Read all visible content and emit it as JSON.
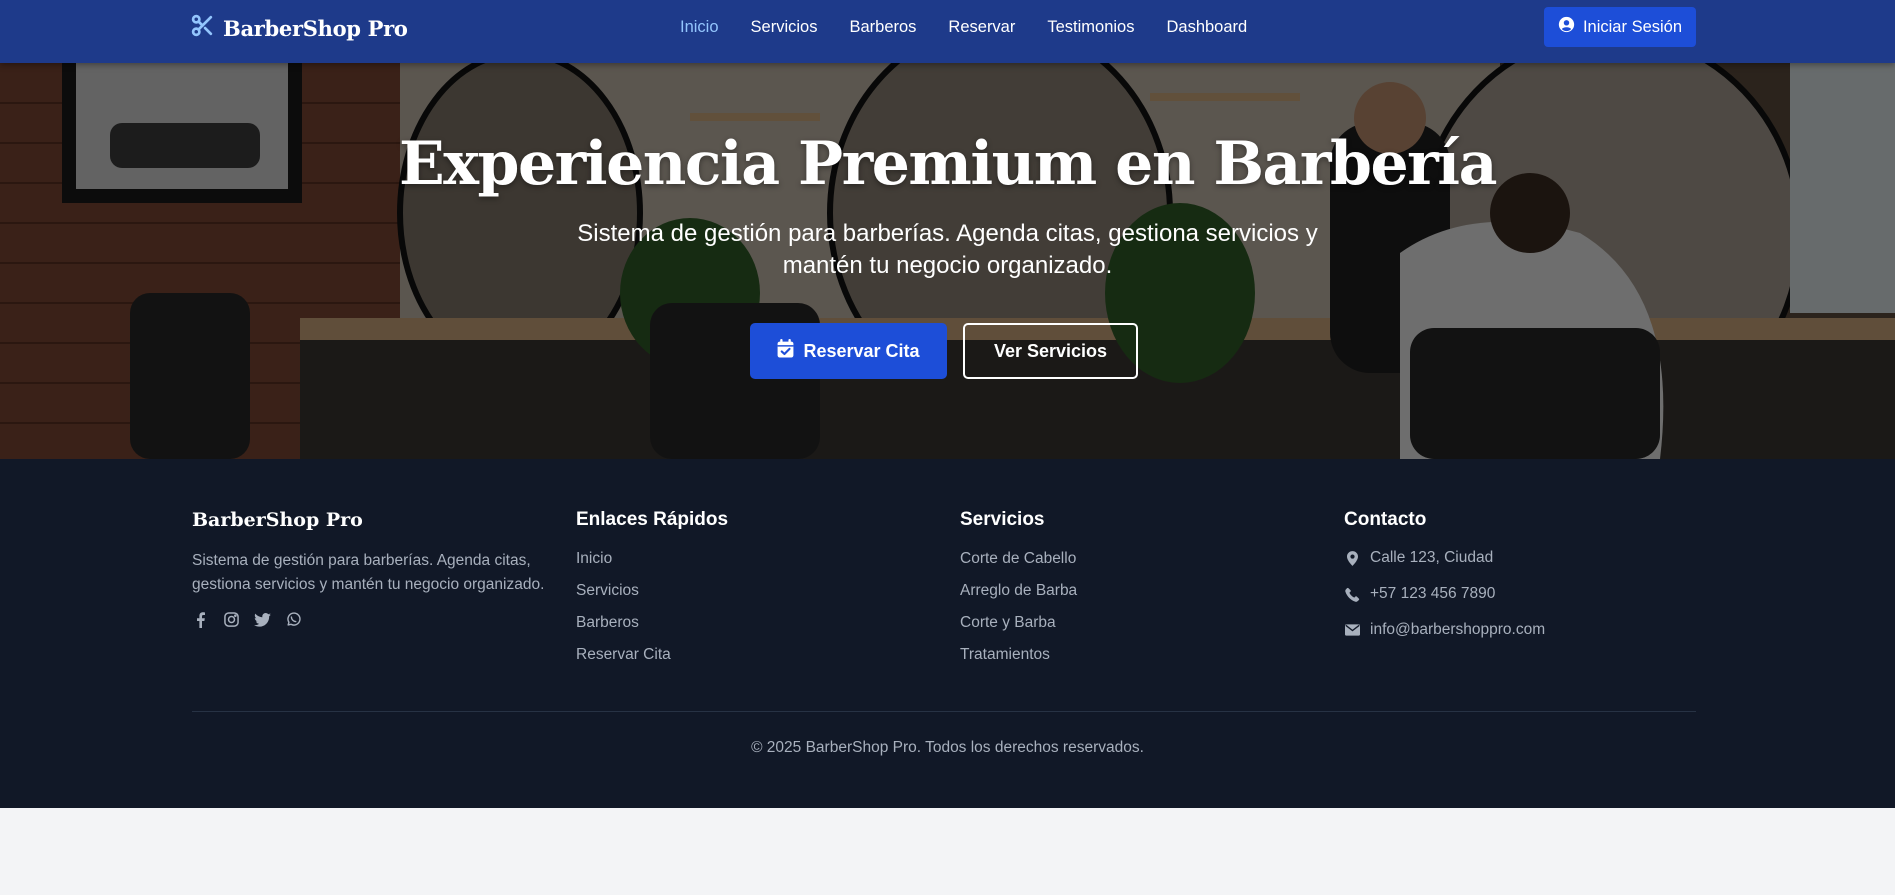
{
  "navbar": {
    "brand": "BarberShop Pro",
    "links": [
      {
        "label": "Inicio",
        "active": true
      },
      {
        "label": "Servicios",
        "active": false
      },
      {
        "label": "Barberos",
        "active": false
      },
      {
        "label": "Reservar",
        "active": false
      },
      {
        "label": "Testimonios",
        "active": false
      },
      {
        "label": "Dashboard",
        "active": false
      }
    ],
    "login_label": "Iniciar Sesión",
    "login_icon": "user-circle-icon",
    "brand_icon": "scissors-icon"
  },
  "hero": {
    "title": "Experiencia Premium en Barbería",
    "subtitle": "Sistema de gestión para barberías. Agenda citas, gestiona servicios y mantén tu negocio organizado.",
    "primary_button": "Reservar Cita",
    "primary_icon": "calendar-check-icon",
    "secondary_button": "Ver Servicios"
  },
  "footer": {
    "about": {
      "title": "BarberShop Pro",
      "text": "Sistema de gestión para barberías. Agenda citas, gestiona servicios y mantén tu negocio organizado.",
      "socials": [
        "facebook-icon",
        "instagram-icon",
        "twitter-icon",
        "whatsapp-icon"
      ]
    },
    "quick_links": {
      "title": "Enlaces Rápidos",
      "items": [
        "Inicio",
        "Servicios",
        "Barberos",
        "Reservar Cita"
      ]
    },
    "services": {
      "title": "Servicios",
      "items": [
        "Corte de Cabello",
        "Arreglo de Barba",
        "Corte y Barba",
        "Tratamientos"
      ]
    },
    "contact": {
      "title": "Contacto",
      "address": "Calle 123, Ciudad",
      "phone": "+57 123 456 7890",
      "email": "info@barbershoppro.com"
    },
    "copyright": "© 2025 BarberShop Pro. Todos los derechos reservados."
  },
  "colors": {
    "navbar_bg": "#1e3a8a",
    "accent": "#1d4ed8",
    "active_link": "#93c5fd",
    "footer_bg": "#111827",
    "muted_text": "#a8b0bd"
  }
}
